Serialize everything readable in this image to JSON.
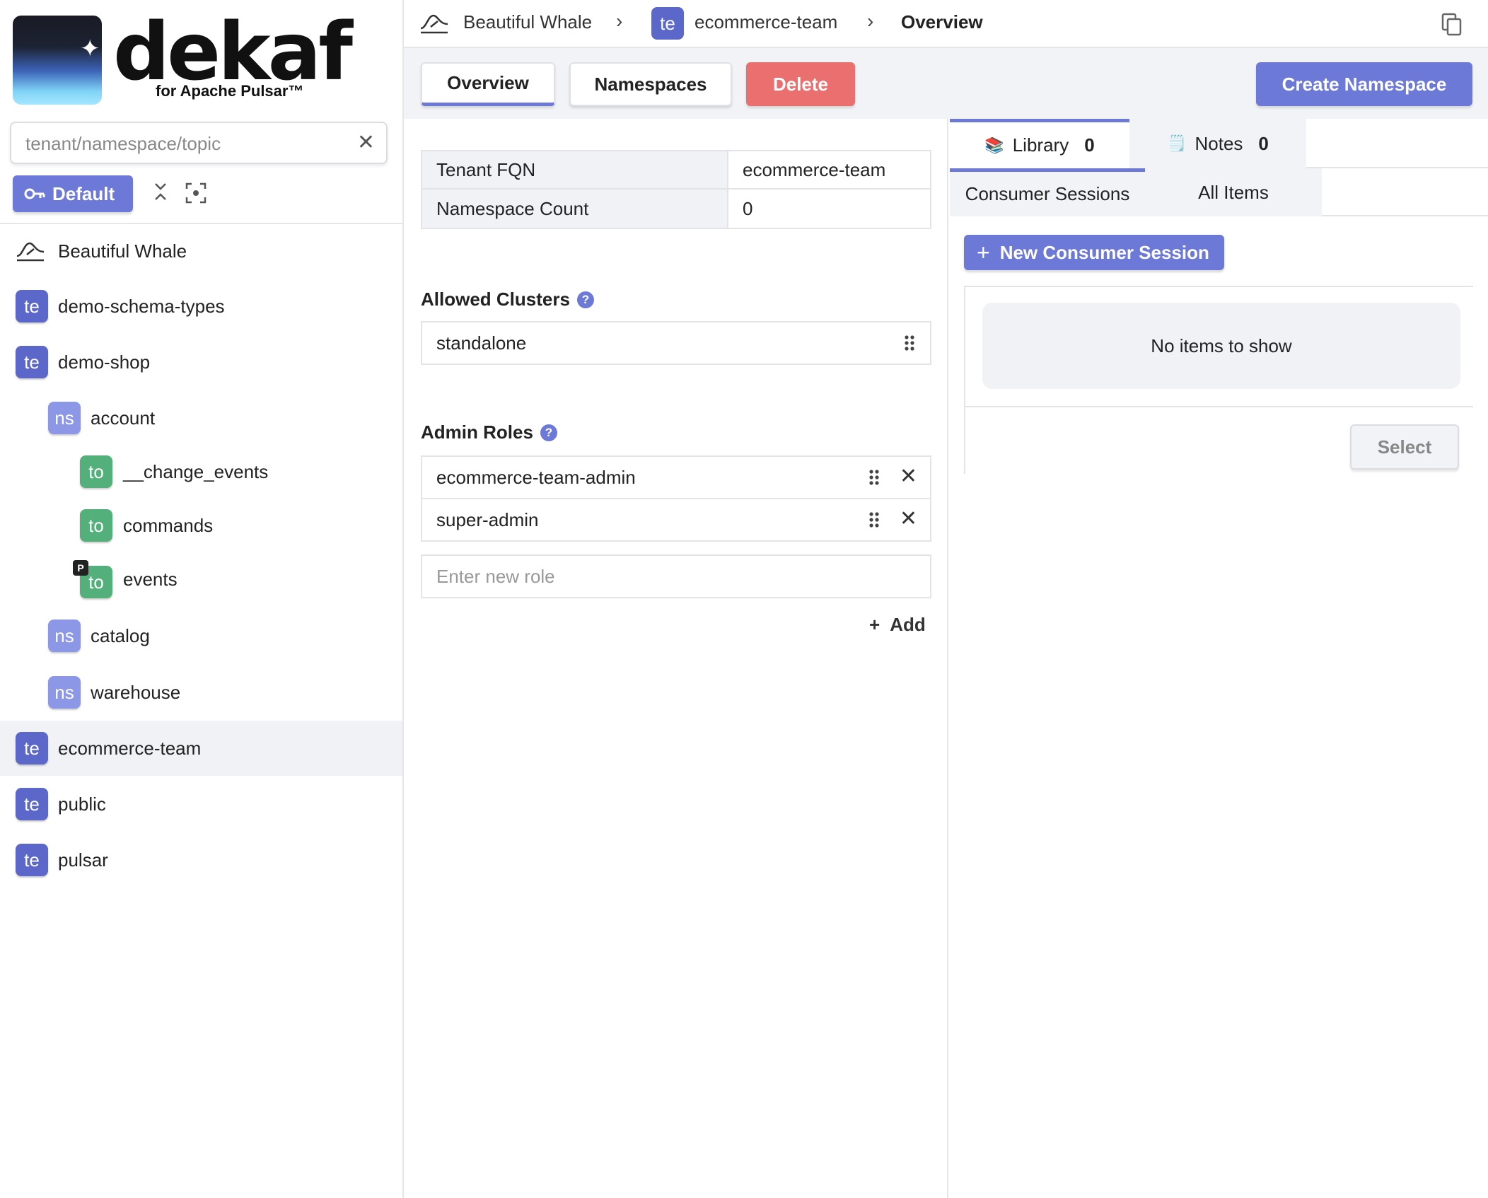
{
  "logo": {
    "wordmark": "dekaf",
    "subtitle": "for Apache Pulsar™"
  },
  "sidebar": {
    "search": {
      "placeholder": "tenant/namespace/topic",
      "value": ""
    },
    "default_button": "Default",
    "tree": [
      {
        "type": "instance",
        "label": "Beautiful Whale"
      },
      {
        "type": "te",
        "badge": "te",
        "label": "demo-schema-types"
      },
      {
        "type": "te",
        "badge": "te",
        "label": "demo-shop"
      },
      {
        "type": "ns",
        "badge": "ns",
        "label": "account"
      },
      {
        "type": "to",
        "badge": "to",
        "label": "__change_events"
      },
      {
        "type": "to",
        "badge": "to",
        "label": "commands"
      },
      {
        "type": "to",
        "badge": "to",
        "label": "events",
        "mark": "P"
      },
      {
        "type": "ns",
        "badge": "ns",
        "label": "catalog"
      },
      {
        "type": "ns",
        "badge": "ns",
        "label": "warehouse"
      },
      {
        "type": "te",
        "badge": "te",
        "label": "ecommerce-team",
        "selected": true
      },
      {
        "type": "te",
        "badge": "te",
        "label": "public"
      },
      {
        "type": "te",
        "badge": "te",
        "label": "pulsar"
      }
    ]
  },
  "breadcrumb": {
    "instance": "Beautiful Whale",
    "tenant_badge": "te",
    "tenant": "ecommerce-team",
    "page": "Overview"
  },
  "toolbar": {
    "overview": "Overview",
    "namespaces": "Namespaces",
    "delete": "Delete",
    "create_namespace": "Create Namespace"
  },
  "main": {
    "table": [
      {
        "key": "Tenant FQN",
        "value": "ecommerce-team"
      },
      {
        "key": "Namespace Count",
        "value": "0"
      }
    ],
    "allowed_clusters": {
      "title": "Allowed Clusters",
      "items": [
        "standalone"
      ]
    },
    "admin_roles": {
      "title": "Admin Roles",
      "items": [
        "ecommerce-team-admin",
        "super-admin"
      ],
      "new_role_placeholder": "Enter new role",
      "add_label": "Add"
    },
    "help_glyph": "?"
  },
  "right_panel": {
    "tabs": [
      {
        "icon": "📚",
        "label": "Library",
        "count": "0"
      },
      {
        "icon": "🗒️",
        "label": "Notes",
        "count": "0"
      }
    ],
    "subtabs": [
      "Consumer Sessions",
      "All Items"
    ],
    "new_session_button": "New Consumer Session",
    "empty_message": "No items to show",
    "select_button": "Select"
  },
  "colors": {
    "accent": "#6c79d6",
    "tenant_badge": "#5b68c9",
    "namespace_badge": "#8c97e6",
    "topic_badge": "#54b07a",
    "danger": "#ea7070"
  }
}
